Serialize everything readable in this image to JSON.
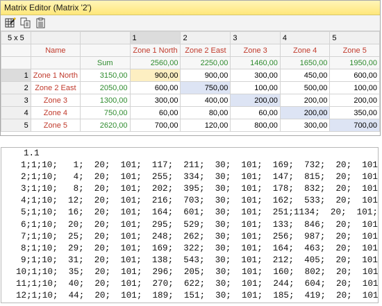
{
  "window": {
    "title": "Matrix Editor (Matrix '2')"
  },
  "toolbar": {
    "buttons": [
      {
        "name": "matrix-wizard-icon"
      },
      {
        "name": "copy-icon"
      },
      {
        "name": "paste-icon"
      }
    ]
  },
  "grid": {
    "size_label": "5 x 5",
    "name_header": "Name",
    "sum_label": "Sum",
    "col_numbers": [
      "1",
      "2",
      "3",
      "4",
      "5"
    ],
    "col_names": [
      "Zone 1 North",
      "Zone 2 East",
      "Zone 3",
      "Zone 4",
      "Zone 5"
    ],
    "col_sums": [
      "2560,00",
      "2250,00",
      "1460,00",
      "1650,00",
      "1950,00"
    ],
    "rows": [
      {
        "num": "1",
        "name": "Zone 1 North",
        "sum": "3150,00",
        "values": [
          "900,00",
          "900,00",
          "300,00",
          "450,00",
          "600,00"
        ]
      },
      {
        "num": "2",
        "name": "Zone 2 East",
        "sum": "2050,00",
        "values": [
          "600,00",
          "750,00",
          "100,00",
          "500,00",
          "100,00"
        ]
      },
      {
        "num": "3",
        "name": "Zone 3",
        "sum": "1300,00",
        "values": [
          "300,00",
          "400,00",
          "200,00",
          "200,00",
          "200,00"
        ]
      },
      {
        "num": "4",
        "name": "Zone 4",
        "sum": "750,00",
        "values": [
          "60,00",
          "80,00",
          "60,00",
          "200,00",
          "350,00"
        ]
      },
      {
        "num": "5",
        "name": "Zone 5",
        "sum": "2620,00",
        "values": [
          "700,00",
          "120,00",
          "800,00",
          "300,00",
          "700,00"
        ]
      }
    ]
  },
  "text_panel": {
    "header": "1.1",
    "lines": [
      "1;1;10;   1;  20;  101;  117;  211;  30;  101;  169;  732;  20;  101;  171;",
      "2;1;10;   4;  20;  101;  255;  334;  30;  101;  147;  815;  20;  101;  124;",
      "3;1;10;   8;  20;  101;  202;  395;  30;  101;  178;  832;  20;  101;  175;",
      "4;1;10;  12;  20;  101;  216;  703;  30;  101;  162;  533;  20;  101;  208;",
      "5;1;10;  16;  20;  101;  164;  601;  30;  101;  251;1134;  20;  101;  159;",
      "6;1;10;  20;  20;  101;  295;  529;  30;  101;  133;  846;  20;  101;  114;",
      "7;1;10;  25;  20;  101;  248;  262;  30;  101;  256;  987;  20;  101;  117;",
      "8;1;10;  29;  20;  101;  169;  322;  30;  101;  164;  463;  20;  101;  141;",
      "9;1;10;  31;  20;  101;  138;  543;  30;  101;  212;  405;  20;  101;  252;",
      "10;1;10;  35;  20;  101;  296;  205;  30;  101;  160;  802;  20;  101;  221;",
      "11;1;10;  40;  20;  101;  270;  622;  30;  101;  244;  604;  20;  101;  175;",
      "12;1;10;  44;  20;  101;  189;  151;  30;  101;  185;  419;  20;  101;  227;"
    ]
  },
  "colors": {
    "title_bar": "#ffe77a",
    "zone_name": "#c0392b",
    "sum_text": "#2e8b2e",
    "diagonal_cell": "#dde4f4",
    "active_cell": "#fdefc2"
  }
}
